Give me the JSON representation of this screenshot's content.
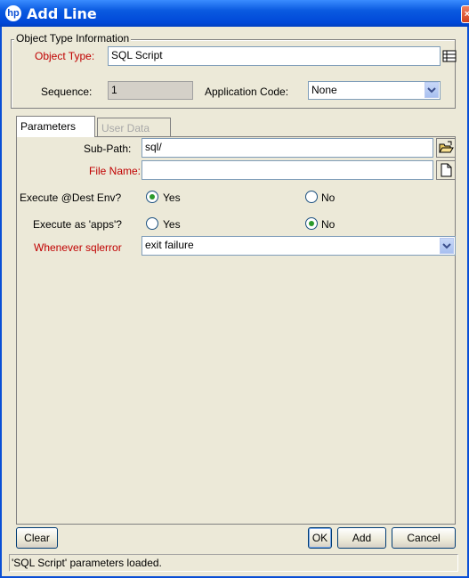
{
  "window": {
    "title": "Add Line"
  },
  "object_type_group": {
    "legend": "Object Type Information",
    "object_type_label": "Object Type:",
    "object_type_value": "SQL Script",
    "sequence_label": "Sequence:",
    "sequence_value": "1",
    "app_code_label": "Application Code:",
    "app_code_value": "None"
  },
  "tabs": [
    {
      "label": "Parameters"
    },
    {
      "label": "User Data"
    }
  ],
  "parameters": {
    "sub_path_label": "Sub-Path:",
    "sub_path_value": "sql/",
    "file_name_label": "File Name:",
    "file_name_value": "",
    "exec_dest_label": "Execute @Dest Env?",
    "exec_dest_yes": "Yes",
    "exec_dest_no": "No",
    "exec_apps_label": "Execute as 'apps'?",
    "exec_apps_yes": "Yes",
    "exec_apps_no": "No",
    "sqlerror_label": "Whenever sqlerror",
    "sqlerror_value": "exit failure"
  },
  "buttons": {
    "clear": "Clear",
    "ok": "OK",
    "add": "Add",
    "cancel": "Cancel"
  },
  "status": {
    "text": "'SQL Script' parameters loaded."
  },
  "colors": {
    "required_label": "#c00000",
    "title_bar": "#0a5ae0"
  }
}
